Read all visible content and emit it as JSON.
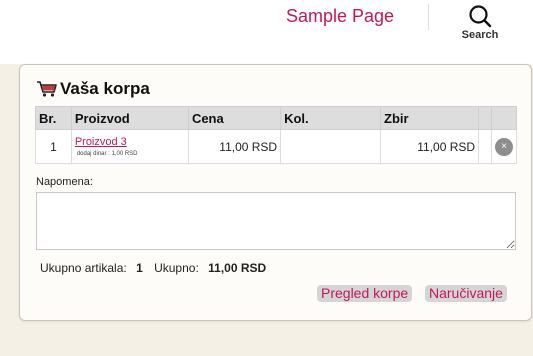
{
  "header": {
    "site_link": "Sample Page",
    "search_label": "Search"
  },
  "cart": {
    "title": "Vaša korpa",
    "columns": [
      "Br.",
      "Proizvod",
      "Cena",
      "Kol.",
      "Zbir",
      ""
    ],
    "rows": [
      {
        "no": "1",
        "product": "Proizvod 3",
        "product_note": "dodaj dinar : 1,00 RSD",
        "price": "11,00 RSD",
        "qty": "",
        "total": "11,00 RSD",
        "remove_glyph": "×"
      }
    ],
    "note_label": "Napomena:",
    "note_value": "",
    "summary": {
      "items_label": "Ukupno artikala:",
      "items_value": "1",
      "total_label": "Ukupno:",
      "total_value": "11,00 RSD"
    },
    "buttons": {
      "review": "Pregled korpe",
      "order": "Naručivanje"
    }
  },
  "colors": {
    "accent": "#c2185b",
    "page_bg": "#f5f0e6",
    "header_bg": "#ffffff",
    "table_header_bg": "#dddddd",
    "button_bg": "#d5d5d5"
  },
  "icons": {
    "search": "search-icon",
    "cart": "shopping-cart-icon",
    "remove": "remove-item-icon"
  }
}
